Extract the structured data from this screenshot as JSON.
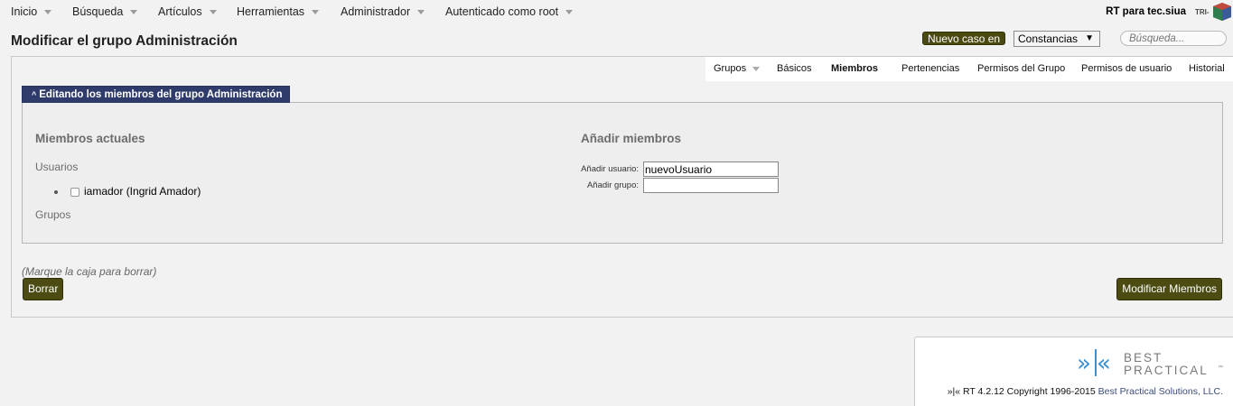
{
  "topnav": {
    "items": [
      {
        "label": "Inicio"
      },
      {
        "label": "Búsqueda"
      },
      {
        "label": "Artículos"
      },
      {
        "label": "Herramientas"
      },
      {
        "label": "Administrador"
      },
      {
        "label": "Autenticado como root"
      }
    ],
    "rt_for": "RT para tec.siua",
    "logo_text": "TRI-"
  },
  "header": {
    "title": "Modificar el grupo Administración",
    "new_ticket_label": "Nuevo caso en",
    "queue_selected": "Constancias",
    "queue_dropdown_glyph": "▼",
    "search_placeholder": "Búsqueda..."
  },
  "tabs": [
    {
      "label": "Grupos",
      "has_caret": true
    },
    {
      "label": "Básicos"
    },
    {
      "label": "Miembros",
      "active": true
    },
    {
      "label": "Pertenencias"
    },
    {
      "label": "Permisos del Grupo"
    },
    {
      "label": "Permisos de usuario"
    },
    {
      "label": "Historial"
    }
  ],
  "titlebox": {
    "title": "Editando los miembros del grupo Administración",
    "collapse_icon": "chevron-up-icon"
  },
  "current_members": {
    "heading": "Miembros actuales",
    "users_label": "Usuarios",
    "users": [
      {
        "label": "iamador (Ingrid Amador)",
        "checked": false
      }
    ],
    "groups_label": "Grupos"
  },
  "add_members": {
    "heading": "Añadir miembros",
    "add_user_label": "Añadir usuario:",
    "add_user_value": "nuevoUsuario",
    "add_group_label": "Añadir grupo:",
    "add_group_value": ""
  },
  "actions": {
    "hint": "(Marque la caja para borrar)",
    "delete_label": "Borrar",
    "modify_label": "Modificar Miembros"
  },
  "footer": {
    "copyright_prefix": "»|« RT 4.2.12 Copyright 1996-2015 ",
    "copyright_link": "Best Practical Solutions, LLC.",
    "logo_line1": "BEST",
    "logo_line2": "PRACTICAL",
    "logo_tm": "™"
  },
  "colors": {
    "accent_olive": "#4b4b12",
    "titlebox_blue": "#2f3c6b",
    "logo_blue": "#3a8fd0"
  }
}
